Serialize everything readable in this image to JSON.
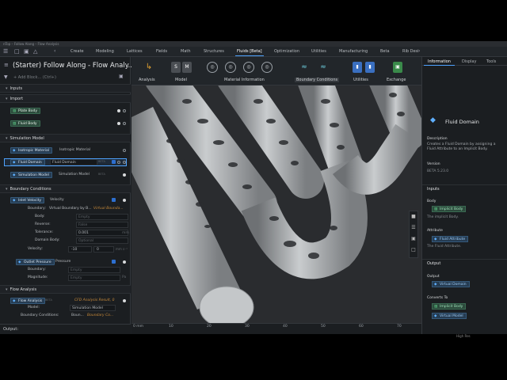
{
  "window": {
    "titlebar_text": "nTop – Follow Along – Flow Analysis",
    "status_text": "High Res"
  },
  "menubar": {
    "tabs": [
      {
        "label": "Create"
      },
      {
        "label": "Modeling"
      },
      {
        "label": "Lattices"
      },
      {
        "label": "Fields"
      },
      {
        "label": "Math"
      },
      {
        "label": "Structures"
      },
      {
        "label": "Fluids [Beta]"
      },
      {
        "label": "Optimization"
      },
      {
        "label": "Utilities"
      },
      {
        "label": "Manufacturing"
      },
      {
        "label": "Beta"
      },
      {
        "label": "Rib Desi"
      }
    ],
    "active_index": 6
  },
  "left_panel": {
    "project_title": "(Starter) Follow Along - Flow Analy...",
    "add_block_placeholder": "+ Add Block... (Ctrl+)",
    "sections": {
      "inputs": "Inputs",
      "import": "Import",
      "simulation_model": "Simulation Model",
      "boundary_conditions": "Boundary Conditions",
      "flow_analysis": "Flow Analysis"
    },
    "import_items": [
      {
        "label": "Plate Body"
      },
      {
        "label": "Fluid Body"
      }
    ],
    "sim_items": {
      "isotropic": {
        "chip": "Isotropic Material",
        "value": "Isotropic Material"
      },
      "fluid_domain": {
        "chip": "Fluid Domain",
        "value": "Fluid Domain",
        "badge": "BETA"
      },
      "simulation_model": {
        "chip": "Simulation Model",
        "value": "Simulation Model",
        "badge": "BETA"
      }
    },
    "inlet": {
      "chip": "Inlet Velocity",
      "value": "Velocity",
      "boundary_label": "Boundary:",
      "boundary_value": "Virtual Boundary by B...",
      "boundary_link": "Virtual Bounda...",
      "badge": "BETA",
      "body_label": "Body:",
      "body_value": "Empty",
      "reverse_label": "Reverse:",
      "reverse_value": "False",
      "tolerance_label": "Tolerance:",
      "tolerance_value": "0.001",
      "tolerance_unit": "mm",
      "domain_label": "Domain Body:",
      "domain_value": "Optional",
      "velocity_label": "Velocity:",
      "velocity_value": "-10",
      "velocity_second": "0",
      "velocity_unit": "mm s⁻¹"
    },
    "outlet": {
      "chip": "Outlet Pressure",
      "value": "Pressure",
      "boundary_label": "Boundary:",
      "boundary_value": "Empty",
      "magnitude_label": "Magnitude:",
      "magnitude_value": "Empty",
      "magnitude_unit": "Pa"
    },
    "flow": {
      "chip": "Flow Analysis",
      "badge": "BETA",
      "value": "CFD Analysis Result, 0",
      "model_label": "Model:",
      "model_value": "Simulation Model",
      "bc_label": "Boundary Conditions:",
      "bc_value": "Boun...",
      "bc_link": "Boundary Co..."
    },
    "output_label": "Output:"
  },
  "toolbar": {
    "groups": [
      {
        "label": "Analysis"
      },
      {
        "label": "Model"
      },
      {
        "label": "Material Information"
      },
      {
        "label": "Boundary Conditions"
      },
      {
        "label": "Utilities"
      },
      {
        "label": "Exchange"
      }
    ],
    "icon_texts": [
      "S",
      "M"
    ]
  },
  "ruler": {
    "ticks": [
      "0 mm",
      "10",
      "20",
      "30",
      "40",
      "50",
      "60",
      "70"
    ]
  },
  "right_panel": {
    "tabs": [
      {
        "label": "Information"
      },
      {
        "label": "Display"
      },
      {
        "label": "Tools"
      }
    ],
    "active_tab": 0,
    "title": "Fluid Domain",
    "description_heading": "Description",
    "description": "Creates a Fluid Domain by assigning a Fluid Attribute to an Implicit Body.",
    "version_heading": "Version",
    "version": "BETA 5.23.0",
    "inputs_heading": "Inputs",
    "body_heading": "Body",
    "body_chip": "Implicit Body",
    "body_desc": "The implicit Body.",
    "attribute_heading": "Attribute",
    "attribute_chip": "Fluid Attribute",
    "attribute_desc": "The Fluid Attribute.",
    "output_heading": "Output",
    "output_sub": "Output",
    "output_chip": "Virtual Domain",
    "converts_heading": "Converts To",
    "converts": [
      {
        "label": "Implicit Body"
      },
      {
        "label": "Virtual Model"
      }
    ]
  },
  "colors": {
    "accent": "#4fa3ff",
    "green_chip": "#2c4a3c",
    "blue_chip": "#263c52",
    "background": "#1d2024",
    "viewport": "#26282b",
    "geometry": "#b9bcbf"
  }
}
